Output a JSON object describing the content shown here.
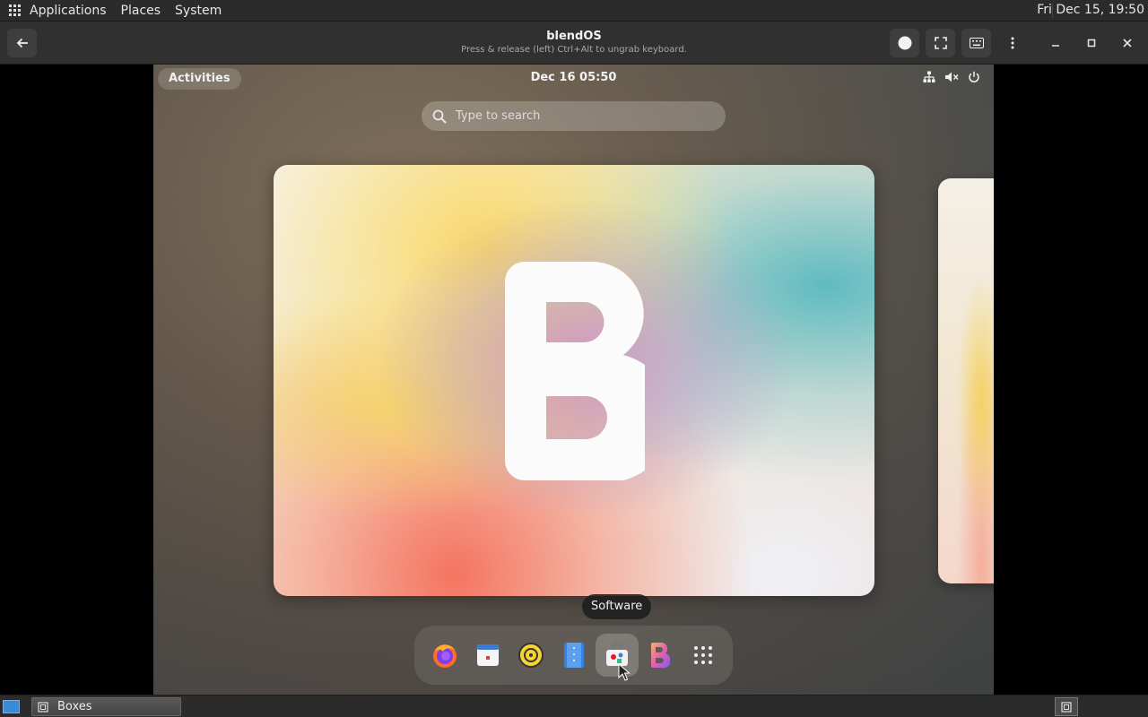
{
  "host_panel": {
    "menus": [
      "Applications",
      "Places",
      "System"
    ],
    "clock": "Fri Dec 15, 19:50"
  },
  "headerbar": {
    "title": "blendOS",
    "subtitle": "Press & release (left) Ctrl+Alt to ungrab keyboard."
  },
  "guest": {
    "activities_label": "Activities",
    "clock": "Dec 16  05:50",
    "search_placeholder": "Type to search",
    "tooltip": "Software",
    "dash_apps": [
      {
        "name": "firefox-icon"
      },
      {
        "name": "calendar-icon"
      },
      {
        "name": "rhythmbox-icon"
      },
      {
        "name": "files-icon"
      },
      {
        "name": "software-icon"
      },
      {
        "name": "blend-icon"
      },
      {
        "name": "app-grid-icon"
      }
    ],
    "hovered_app": "software-icon"
  },
  "taskbar": {
    "task_label": "Boxes"
  }
}
